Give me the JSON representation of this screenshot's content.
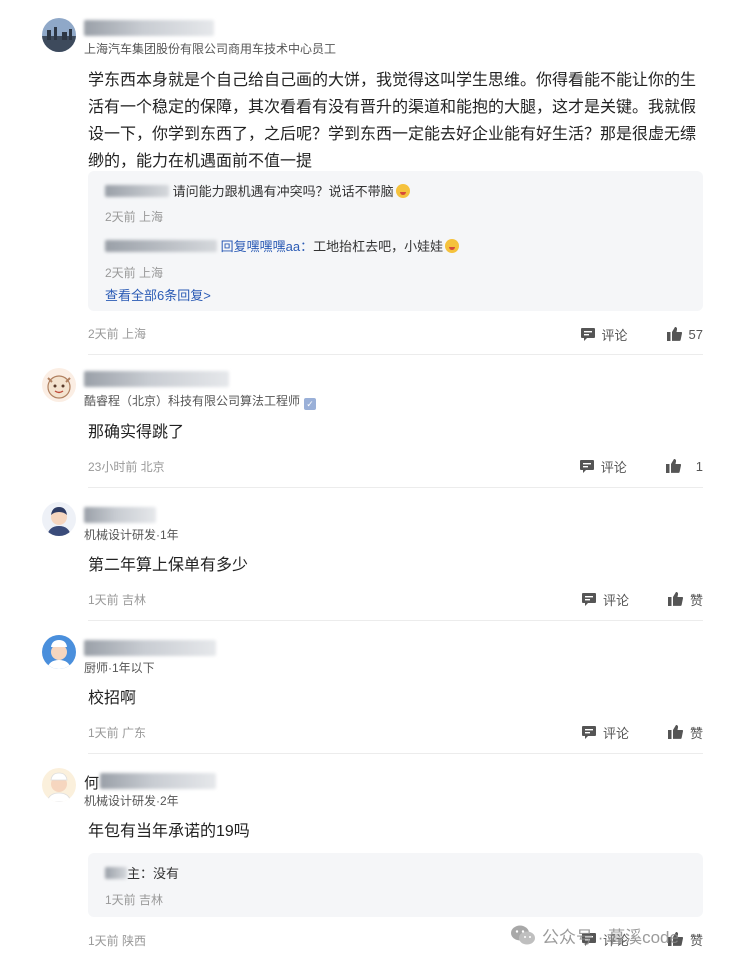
{
  "comments": [
    {
      "title": "上海汽车集团股份有限公司商用车技术中心员工",
      "body": "学东西本身就是个自己给自己画的大饼，我觉得这叫学生思维。你得看能不能让你的生活有一个稳定的保障，其次看看有没有晋升的渠道和能抱的大腿，这才是关键。我就假设一下，你学到东西了，之后呢？学到东西一定能去好企业能有好生活？那是很虚无缥缈的，能力在机遇面前不值一提",
      "replies": [
        {
          "text": "请问能力跟机遇有冲突吗？说话不带脑",
          "meta": "2天前 上海"
        },
        {
          "reply_to": "回复嘿嘿嘿aa：",
          "text": "工地抬杠去吧，小娃娃",
          "meta": "2天前 上海"
        }
      ],
      "view_all": "查看全部6条回复>",
      "meta": "2天前 上海",
      "comment_label": "评论",
      "likes": "57"
    },
    {
      "title": "酷睿程（北京）科技有限公司算法工程师",
      "body": "那确实得跳了",
      "meta": "23小时前 北京",
      "comment_label": "评论",
      "likes": "1"
    },
    {
      "title": "机械设计研发·1年",
      "body": "第二年算上保单有多少",
      "meta": "1天前 吉林",
      "comment_label": "评论",
      "likes": "赞"
    },
    {
      "title": "厨师·1年以下",
      "body": "校招啊",
      "meta": "1天前 广东",
      "comment_label": "评论",
      "likes": "赞"
    },
    {
      "name_prefix": "何",
      "title": "机械设计研发·2年",
      "body": "年包有当年承诺的19吗",
      "reply_suffix": "主：没有",
      "reply_meta": "1天前 吉林",
      "meta": "1天前 陕西",
      "comment_label": "评论",
      "likes": "赞"
    }
  ],
  "watermark": {
    "text": "公众号 · 暮溪code"
  },
  "colors": {
    "link": "#2b5bb5",
    "meta": "#999999",
    "reply_bg": "#f5f6f8"
  }
}
